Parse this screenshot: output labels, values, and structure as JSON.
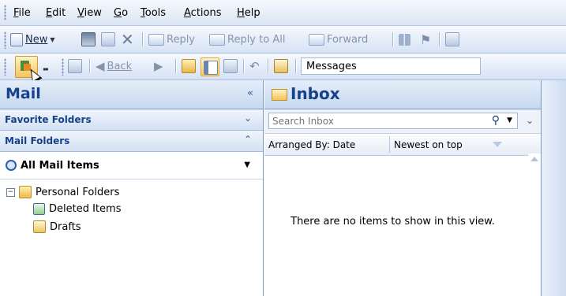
{
  "menubar": {
    "items": [
      {
        "label": "File",
        "key": "F"
      },
      {
        "label": "Edit",
        "key": "E"
      },
      {
        "label": "View",
        "key": "V"
      },
      {
        "label": "Go",
        "key": "G"
      },
      {
        "label": "Tools",
        "key": "T"
      },
      {
        "label": "Actions",
        "key": "A"
      },
      {
        "label": "Help",
        "key": "H"
      }
    ]
  },
  "toolbar1": {
    "new_label": "New",
    "reply_label": "Reply",
    "reply_all_label": "Reply to All",
    "forward_label": "Forward"
  },
  "toolbar2": {
    "back_label": "Back",
    "address_value": "Messages"
  },
  "nav": {
    "title": "Mail",
    "favorite_folders": "Favorite Folders",
    "mail_folders": "Mail Folders",
    "all_mail_items": "All Mail Items",
    "tree": [
      {
        "label": "Personal Folders"
      },
      {
        "label": "Deleted Items"
      },
      {
        "label": "Drafts"
      }
    ]
  },
  "inbox": {
    "title": "Inbox",
    "search_placeholder": "Search Inbox",
    "arranged_by": "Arranged By: Date",
    "sort_order": "Newest on top",
    "empty_message": "There are no items to show in this view."
  }
}
